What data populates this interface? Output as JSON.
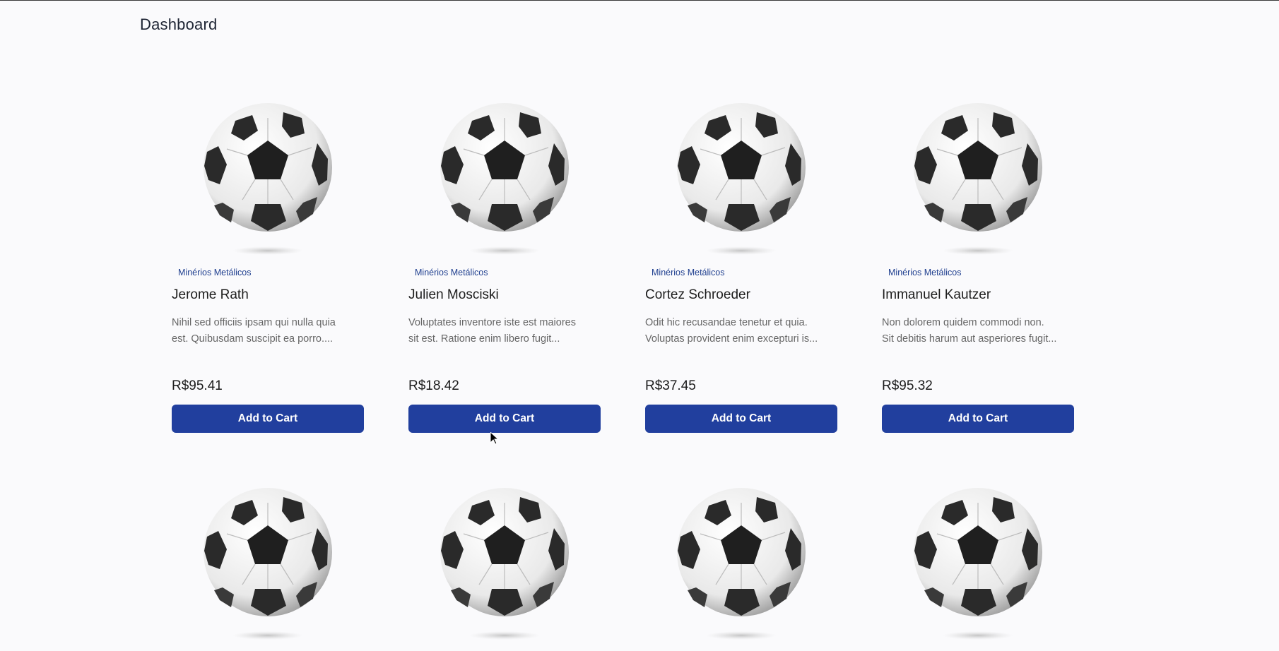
{
  "header": {
    "title": "Dashboard"
  },
  "products": [
    {
      "category": "Minérios Metálicos",
      "name": "Jerome Rath",
      "desc_line1": "Nihil sed officiis ipsam qui nulla quia",
      "desc_line2": "est. Quibusdam suscipit ea porro....",
      "price": "R$95.41",
      "button": "Add to Cart",
      "image_icon": "soccer-ball-icon"
    },
    {
      "category": "Minérios Metálicos",
      "name": "Julien Mosciski",
      "desc_line1": "Voluptates inventore iste est maiores",
      "desc_line2": "sit est. Ratione enim libero fugit...",
      "price": "R$18.42",
      "button": "Add to Cart",
      "image_icon": "soccer-ball-icon"
    },
    {
      "category": "Minérios Metálicos",
      "name": "Cortez Schroeder",
      "desc_line1": "Odit hic recusandae tenetur et quia.",
      "desc_line2": "Voluptas provident enim excepturi is...",
      "price": "R$37.45",
      "button": "Add to Cart",
      "image_icon": "soccer-ball-icon"
    },
    {
      "category": "Minérios Metálicos",
      "name": "Immanuel Kautzer",
      "desc_line1": "Non dolorem quidem commodi non.",
      "desc_line2": "Sit debitis harum aut asperiores fugit...",
      "price": "R$95.32",
      "button": "Add to Cart",
      "image_icon": "soccer-ball-icon"
    }
  ],
  "second_row_images": [
    "soccer-ball-icon",
    "soccer-ball-icon",
    "soccer-ball-icon",
    "soccer-ball-icon"
  ],
  "colors": {
    "accent": "#213f9e",
    "category": "#1f3f8f",
    "background": "#fafafc"
  }
}
